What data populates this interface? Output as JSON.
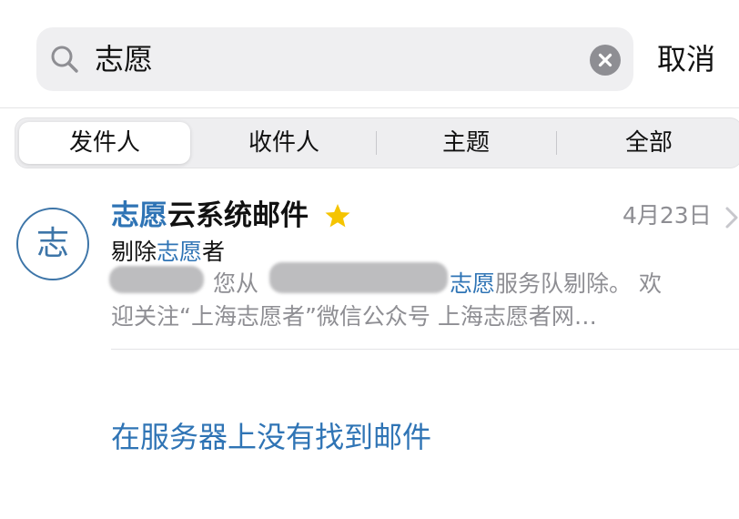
{
  "search": {
    "query": "志愿",
    "cancel_label": "取消"
  },
  "scopes": [
    {
      "label": "发件人",
      "selected": true
    },
    {
      "label": "收件人",
      "selected": false
    },
    {
      "label": "主题",
      "selected": false
    },
    {
      "label": "全部",
      "selected": false
    }
  ],
  "message": {
    "avatar_char": "志",
    "sender_highlight": "志愿",
    "sender_rest": "云系统邮件",
    "starred": true,
    "date": "4月23日",
    "subject_prefix": "剔除",
    "subject_highlight": "志愿",
    "subject_suffix": "者",
    "preview_line1_a": "您从",
    "preview_line1_highlight": "志愿",
    "preview_line1_b": "服务队剔除。 欢",
    "preview_line2": "迎关注“上海志愿者”微信公众号 上海志愿者网…"
  },
  "server_search_link": "在服务器上没有找到邮件",
  "colors": {
    "accent": "#2f74b5",
    "star": "#f5c400",
    "secondary_text": "#8e8e93"
  }
}
